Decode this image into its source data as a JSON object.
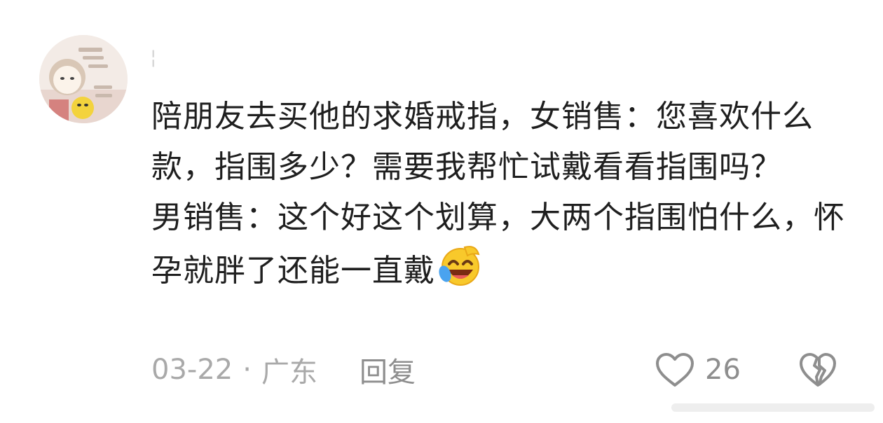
{
  "comment": {
    "lines": [
      "陪朋友去买他的求婚戒指，女销售：您喜欢什么款，指围多少？需要我帮忙试戴看看指围吗？",
      "男销售：这个好这个划算，大两个指围怕什么，怀孕就胖了还能一直戴"
    ],
    "emoji": "crying-laughing-emoji"
  },
  "meta": {
    "date": "03-22",
    "separator": "·",
    "location": "广东",
    "reply_label": "回复"
  },
  "actions": {
    "like_count": "26",
    "like_icon": "heart-outline-icon",
    "dislike_icon": "broken-heart-icon"
  },
  "colors": {
    "text": "#1f1f1f",
    "meta": "#a9a9a9",
    "icon": "#8e8e8e"
  }
}
